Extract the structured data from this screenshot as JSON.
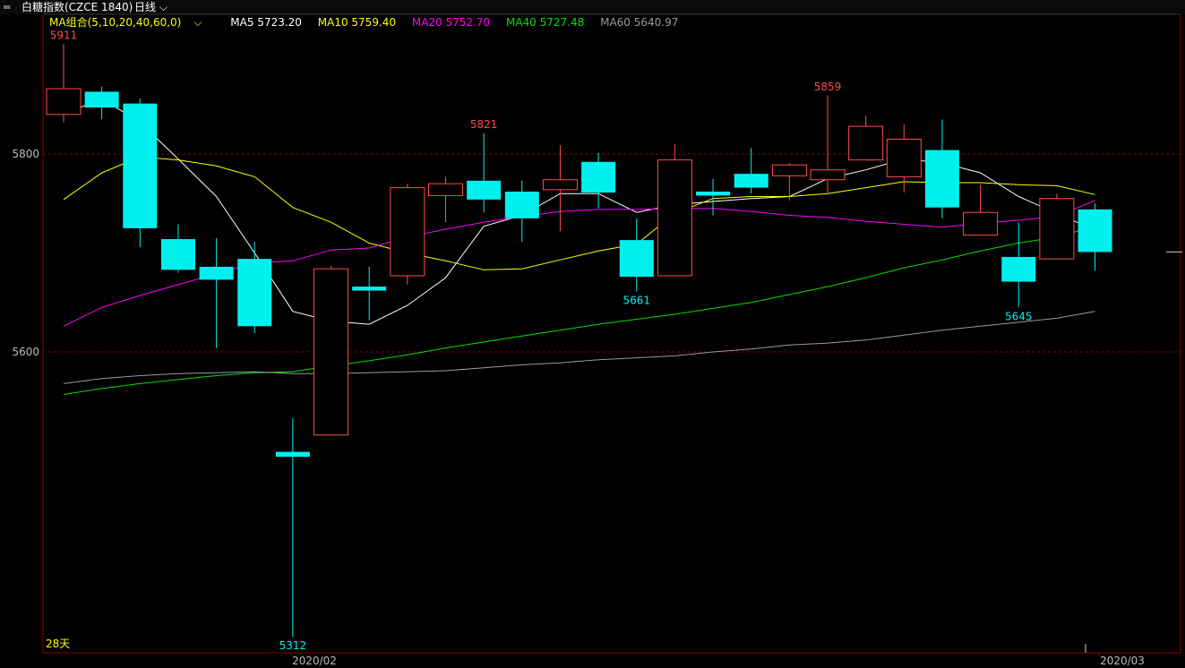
{
  "header": {
    "symbol": "白糖指数(CZCE 1840)",
    "period": "日线",
    "period_icon": "chevron-down-icon",
    "symbol_icon": "link-icon"
  },
  "legend": {
    "group": "MA组合(5,10,20,40,60,0)",
    "ma5": "MA5 5723.20",
    "ma10": "MA10 5759.40",
    "ma20": "MA20 5752.70",
    "ma40": "MA40 5727.48",
    "ma60": "MA60 5640.97"
  },
  "colors": {
    "up": "#ff4b4b",
    "down": "#00f0f0",
    "ma5": "#ffffff",
    "ma10": "#ffff00",
    "ma20": "#ff00ff",
    "ma40": "#00e000",
    "ma60": "#9a9a9a",
    "grid": "#8b0000"
  },
  "chart_data": {
    "type": "candlestick",
    "y_ticks": [
      5800,
      5600
    ],
    "x_ticks": [
      "2020/02",
      "2020/03"
    ],
    "bottom_label": "28天",
    "annotations": [
      {
        "text": "5911",
        "index": 0,
        "kind": "high"
      },
      {
        "text": "5312",
        "index": 6,
        "kind": "low"
      },
      {
        "text": "5821",
        "index": 11,
        "kind": "high"
      },
      {
        "text": "5661",
        "index": 15,
        "kind": "low"
      },
      {
        "text": "5859",
        "index": 20,
        "kind": "high"
      },
      {
        "text": "5645",
        "index": 25,
        "kind": "low"
      }
    ],
    "candles": [
      {
        "o": 5840,
        "h": 5911,
        "l": 5832,
        "c": 5866
      },
      {
        "o": 5863,
        "h": 5868,
        "l": 5835,
        "c": 5847
      },
      {
        "o": 5851,
        "h": 5856,
        "l": 5706,
        "c": 5725
      },
      {
        "o": 5714,
        "h": 5729,
        "l": 5680,
        "c": 5683
      },
      {
        "o": 5686,
        "h": 5715,
        "l": 5604,
        "c": 5673
      },
      {
        "o": 5694,
        "h": 5711,
        "l": 5619,
        "c": 5626
      },
      {
        "o": 5499,
        "h": 5533,
        "l": 5312,
        "c": 5494
      },
      {
        "o": 5516,
        "h": 5687,
        "l": 5516,
        "c": 5684
      },
      {
        "o": 5666,
        "h": 5686,
        "l": 5632,
        "c": 5662
      },
      {
        "o": 5677,
        "h": 5770,
        "l": 5668,
        "c": 5766
      },
      {
        "o": 5758,
        "h": 5777,
        "l": 5731,
        "c": 5770
      },
      {
        "o": 5773,
        "h": 5821,
        "l": 5741,
        "c": 5754
      },
      {
        "o": 5762,
        "h": 5773,
        "l": 5711,
        "c": 5735
      },
      {
        "o": 5764,
        "h": 5809,
        "l": 5722,
        "c": 5774
      },
      {
        "o": 5792,
        "h": 5801,
        "l": 5745,
        "c": 5761
      },
      {
        "o": 5713,
        "h": 5735,
        "l": 5661,
        "c": 5676
      },
      {
        "o": 5677,
        "h": 5810,
        "l": 5677,
        "c": 5794
      },
      {
        "o": 5762,
        "h": 5775,
        "l": 5738,
        "c": 5758
      },
      {
        "o": 5780,
        "h": 5806,
        "l": 5760,
        "c": 5766
      },
      {
        "o": 5778,
        "h": 5791,
        "l": 5753,
        "c": 5789
      },
      {
        "o": 5774,
        "h": 5859,
        "l": 5759,
        "c": 5784
      },
      {
        "o": 5794,
        "h": 5839,
        "l": 5794,
        "c": 5828
      },
      {
        "o": 5777,
        "h": 5830,
        "l": 5761,
        "c": 5815
      },
      {
        "o": 5804,
        "h": 5835,
        "l": 5735,
        "c": 5746
      },
      {
        "o": 5718,
        "h": 5769,
        "l": 5718,
        "c": 5741
      },
      {
        "o": 5696,
        "h": 5731,
        "l": 5645,
        "c": 5671
      },
      {
        "o": 5694,
        "h": 5760,
        "l": 5694,
        "c": 5755
      },
      {
        "o": 5744,
        "h": 5750,
        "l": 5682,
        "c": 5701
      }
    ],
    "series": [
      {
        "name": "MA5",
        "values": [
          5840,
          5856,
          5832,
          5795,
          5757,
          5700,
          5641,
          5631,
          5628,
          5647,
          5675,
          5727,
          5738,
          5760,
          5760,
          5741,
          5749,
          5752,
          5755,
          5757,
          5775,
          5784,
          5795,
          5791,
          5781,
          5757,
          5740,
          5723
        ]
      },
      {
        "name": "MA10",
        "values": [
          5754,
          5781,
          5797,
          5794,
          5788,
          5777,
          5746,
          5731,
          5710,
          5700,
          5692,
          5683,
          5684,
          5693,
          5702,
          5709,
          5740,
          5755,
          5757,
          5757,
          5760,
          5766,
          5772,
          5771,
          5771,
          5769,
          5768,
          5759
        ]
      },
      {
        "name": "MA20",
        "values": [
          5626,
          5645,
          5657,
          5668,
          5679,
          5690,
          5692,
          5703,
          5705,
          5716,
          5724,
          5731,
          5737,
          5742,
          5744,
          5744,
          5745,
          5745,
          5742,
          5738,
          5736,
          5732,
          5729,
          5726,
          5730,
          5733,
          5737,
          5753
        ]
      },
      {
        "name": "MA40",
        "values": [
          5557,
          5563,
          5568,
          5572,
          5576,
          5579,
          5580,
          5586,
          5591,
          5597,
          5604,
          5610,
          5616,
          5622,
          5628,
          5633,
          5638,
          5644,
          5650,
          5658,
          5666,
          5675,
          5685,
          5693,
          5702,
          5710,
          5716,
          5727
        ]
      },
      {
        "name": "MA60",
        "values": [
          5568,
          5573,
          5576,
          5578,
          5579,
          5580,
          5578,
          5578,
          5579,
          5580,
          5581,
          5584,
          5587,
          5589,
          5592,
          5594,
          5596,
          5600,
          5603,
          5607,
          5609,
          5612,
          5617,
          5622,
          5626,
          5630,
          5634,
          5641
        ]
      }
    ]
  }
}
